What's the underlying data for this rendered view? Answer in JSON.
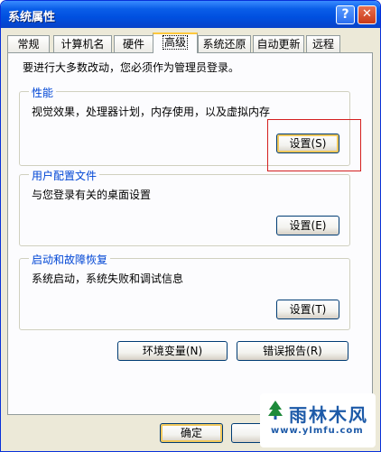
{
  "window": {
    "title": "系统属性",
    "help_icon": "?",
    "close_icon": "✕"
  },
  "tabs": [
    {
      "label": "常规"
    },
    {
      "label": "计算机名"
    },
    {
      "label": "硬件"
    },
    {
      "label": "高级",
      "active": true
    },
    {
      "label": "系统还原"
    },
    {
      "label": "自动更新"
    },
    {
      "label": "远程"
    }
  ],
  "intro": "要进行大多数改动，您必须作为管理员登录。",
  "performance": {
    "title": "性能",
    "description": "视觉效果，处理器计划，内存使用，以及虚拟内存",
    "button": "设置(S)"
  },
  "user_profiles": {
    "title": "用户配置文件",
    "description": "与您登录有关的桌面设置",
    "button": "设置(E)"
  },
  "startup_recovery": {
    "title": "启动和故障恢复",
    "description": "系统启动，系统失败和调试信息",
    "button": "设置(T)"
  },
  "env_vars_button": "环境变量(N)",
  "error_report_button": "错误报告(R)",
  "ok_button": "确定",
  "watermark": {
    "main": "雨林木风",
    "sub": "www.ylmfu.com"
  },
  "colors": {
    "title_bar": "#0a5ee8",
    "group_title": "#0046d5",
    "highlight_box": "#d42020"
  }
}
